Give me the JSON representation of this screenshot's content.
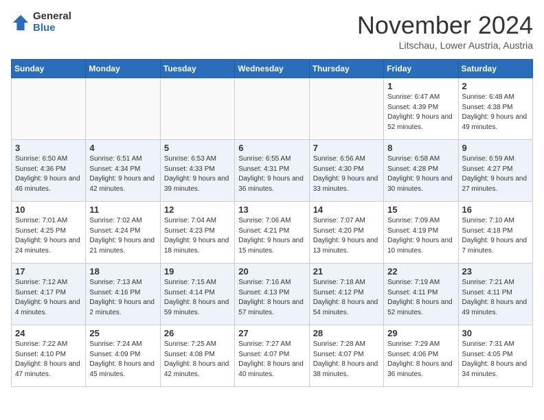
{
  "logo": {
    "general": "General",
    "blue": "Blue"
  },
  "header": {
    "month": "November 2024",
    "location": "Litschau, Lower Austria, Austria"
  },
  "weekdays": [
    "Sunday",
    "Monday",
    "Tuesday",
    "Wednesday",
    "Thursday",
    "Friday",
    "Saturday"
  ],
  "weeks": [
    [
      {
        "day": "",
        "info": ""
      },
      {
        "day": "",
        "info": ""
      },
      {
        "day": "",
        "info": ""
      },
      {
        "day": "",
        "info": ""
      },
      {
        "day": "",
        "info": ""
      },
      {
        "day": "1",
        "info": "Sunrise: 6:47 AM\nSunset: 4:39 PM\nDaylight: 9 hours\nand 52 minutes."
      },
      {
        "day": "2",
        "info": "Sunrise: 6:48 AM\nSunset: 4:38 PM\nDaylight: 9 hours\nand 49 minutes."
      }
    ],
    [
      {
        "day": "3",
        "info": "Sunrise: 6:50 AM\nSunset: 4:36 PM\nDaylight: 9 hours\nand 46 minutes."
      },
      {
        "day": "4",
        "info": "Sunrise: 6:51 AM\nSunset: 4:34 PM\nDaylight: 9 hours\nand 42 minutes."
      },
      {
        "day": "5",
        "info": "Sunrise: 6:53 AM\nSunset: 4:33 PM\nDaylight: 9 hours\nand 39 minutes."
      },
      {
        "day": "6",
        "info": "Sunrise: 6:55 AM\nSunset: 4:31 PM\nDaylight: 9 hours\nand 36 minutes."
      },
      {
        "day": "7",
        "info": "Sunrise: 6:56 AM\nSunset: 4:30 PM\nDaylight: 9 hours\nand 33 minutes."
      },
      {
        "day": "8",
        "info": "Sunrise: 6:58 AM\nSunset: 4:28 PM\nDaylight: 9 hours\nand 30 minutes."
      },
      {
        "day": "9",
        "info": "Sunrise: 6:59 AM\nSunset: 4:27 PM\nDaylight: 9 hours\nand 27 minutes."
      }
    ],
    [
      {
        "day": "10",
        "info": "Sunrise: 7:01 AM\nSunset: 4:25 PM\nDaylight: 9 hours\nand 24 minutes."
      },
      {
        "day": "11",
        "info": "Sunrise: 7:02 AM\nSunset: 4:24 PM\nDaylight: 9 hours\nand 21 minutes."
      },
      {
        "day": "12",
        "info": "Sunrise: 7:04 AM\nSunset: 4:23 PM\nDaylight: 9 hours\nand 18 minutes."
      },
      {
        "day": "13",
        "info": "Sunrise: 7:06 AM\nSunset: 4:21 PM\nDaylight: 9 hours\nand 15 minutes."
      },
      {
        "day": "14",
        "info": "Sunrise: 7:07 AM\nSunset: 4:20 PM\nDaylight: 9 hours\nand 13 minutes."
      },
      {
        "day": "15",
        "info": "Sunrise: 7:09 AM\nSunset: 4:19 PM\nDaylight: 9 hours\nand 10 minutes."
      },
      {
        "day": "16",
        "info": "Sunrise: 7:10 AM\nSunset: 4:18 PM\nDaylight: 9 hours\nand 7 minutes."
      }
    ],
    [
      {
        "day": "17",
        "info": "Sunrise: 7:12 AM\nSunset: 4:17 PM\nDaylight: 9 hours\nand 4 minutes."
      },
      {
        "day": "18",
        "info": "Sunrise: 7:13 AM\nSunset: 4:16 PM\nDaylight: 9 hours\nand 2 minutes."
      },
      {
        "day": "19",
        "info": "Sunrise: 7:15 AM\nSunset: 4:14 PM\nDaylight: 8 hours\nand 59 minutes."
      },
      {
        "day": "20",
        "info": "Sunrise: 7:16 AM\nSunset: 4:13 PM\nDaylight: 8 hours\nand 57 minutes."
      },
      {
        "day": "21",
        "info": "Sunrise: 7:18 AM\nSunset: 4:12 PM\nDaylight: 8 hours\nand 54 minutes."
      },
      {
        "day": "22",
        "info": "Sunrise: 7:19 AM\nSunset: 4:11 PM\nDaylight: 8 hours\nand 52 minutes."
      },
      {
        "day": "23",
        "info": "Sunrise: 7:21 AM\nSunset: 4:11 PM\nDaylight: 8 hours\nand 49 minutes."
      }
    ],
    [
      {
        "day": "24",
        "info": "Sunrise: 7:22 AM\nSunset: 4:10 PM\nDaylight: 8 hours\nand 47 minutes."
      },
      {
        "day": "25",
        "info": "Sunrise: 7:24 AM\nSunset: 4:09 PM\nDaylight: 8 hours\nand 45 minutes."
      },
      {
        "day": "26",
        "info": "Sunrise: 7:25 AM\nSunset: 4:08 PM\nDaylight: 8 hours\nand 42 minutes."
      },
      {
        "day": "27",
        "info": "Sunrise: 7:27 AM\nSunset: 4:07 PM\nDaylight: 8 hours\nand 40 minutes."
      },
      {
        "day": "28",
        "info": "Sunrise: 7:28 AM\nSunset: 4:07 PM\nDaylight: 8 hours\nand 38 minutes."
      },
      {
        "day": "29",
        "info": "Sunrise: 7:29 AM\nSunset: 4:06 PM\nDaylight: 8 hours\nand 36 minutes."
      },
      {
        "day": "30",
        "info": "Sunrise: 7:31 AM\nSunset: 4:05 PM\nDaylight: 8 hours\nand 34 minutes."
      }
    ]
  ]
}
